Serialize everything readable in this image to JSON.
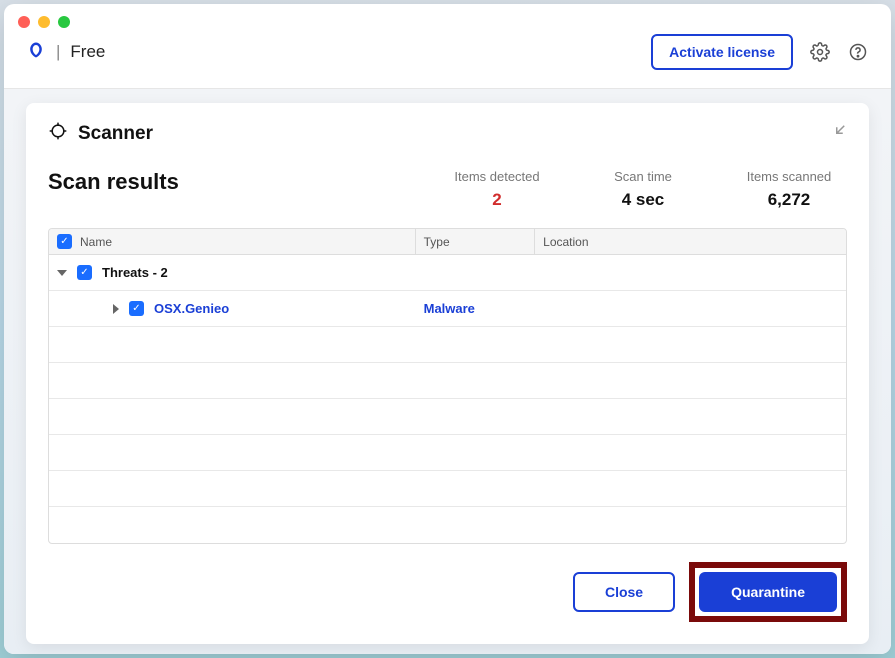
{
  "topbar": {
    "brand_tier": "Free",
    "activate_label": "Activate license"
  },
  "panel": {
    "title": "Scanner",
    "results_title": "Scan results",
    "stats": {
      "detected_label": "Items detected",
      "detected_value": "2",
      "time_label": "Scan time",
      "time_value": "4 sec",
      "scanned_label": "Items scanned",
      "scanned_value": "6,272"
    },
    "columns": {
      "name": "Name",
      "type": "Type",
      "location": "Location"
    },
    "group": {
      "label": "Threats - 2"
    },
    "threat": {
      "name": "OSX.Genieo",
      "type": "Malware",
      "location": ""
    },
    "buttons": {
      "close": "Close",
      "quarantine": "Quarantine"
    }
  }
}
